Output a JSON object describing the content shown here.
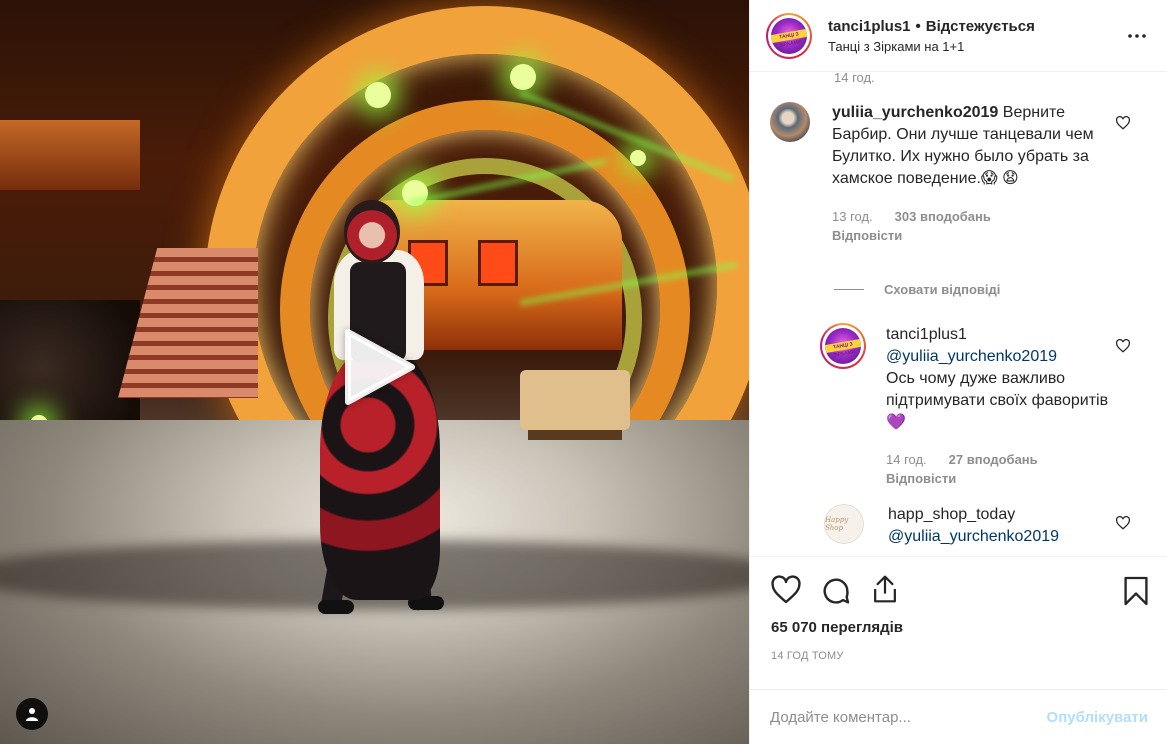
{
  "post": {
    "username": "tanci1plus1",
    "follow_status": "Відстежується",
    "subtitle": "Танці з Зірками на 1+1",
    "logo_text": "ТАНЦІ З ЗІРКАМИ"
  },
  "comments": {
    "top_timestamp": "14 год.",
    "items": [
      {
        "username": "yuliia_yurchenko2019",
        "text": "Верните Барбир. Они лучше танцевали чем Булитко. Их нужно было убрать за хамское поведение.😱 😧",
        "time": "13 год.",
        "likes": "303 вподобань",
        "reply_label": "Відповісти"
      }
    ],
    "hide_replies_label": "Сховати відповіді",
    "replies": [
      {
        "username": "tanci1plus1",
        "mention": "@yuliia_yurchenko2019",
        "text": "Ось чому дуже важливо підтримувати своїх фаворитів 💜",
        "time": "14 год.",
        "likes": "27 вподобань",
        "reply_label": "Відповісти"
      },
      {
        "username": "happ_shop_today",
        "mention": "@yuliia_yurchenko2019",
        "avatar_text": "Happy Shop"
      }
    ]
  },
  "stats": {
    "views": "65 070 переглядів",
    "posted_ago": "14 ГОД ТОМУ"
  },
  "composer": {
    "placeholder": "Додайте коментар...",
    "publish_label": "Опублікувати"
  },
  "colors": {
    "link": "#00376b",
    "muted": "#8e8e8e",
    "publish_disabled": "#b2dffc"
  },
  "icons": [
    "play-icon",
    "user-tag-icon",
    "more-icon",
    "heart-icon",
    "comment-icon",
    "share-icon",
    "bookmark-icon"
  ]
}
